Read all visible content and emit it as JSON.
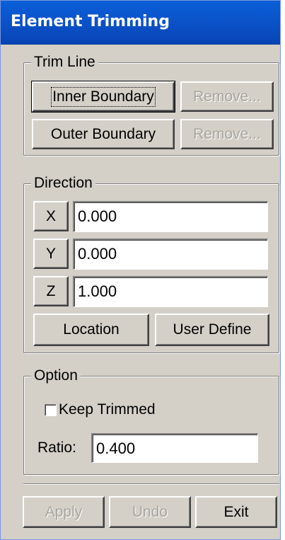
{
  "window": {
    "title": "Element Trimming"
  },
  "trim_line": {
    "legend": "Trim Line",
    "inner_boundary_label": "Inner Boundary",
    "outer_boundary_label": "Outer Boundary",
    "remove_inner_label": "Remove...",
    "remove_outer_label": "Remove..."
  },
  "direction": {
    "legend": "Direction",
    "x_label": "X",
    "y_label": "Y",
    "z_label": "Z",
    "x_value": "0.000",
    "y_value": "0.000",
    "z_value": "1.000",
    "location_label": "Location",
    "user_define_label": "User Define"
  },
  "option": {
    "legend": "Option",
    "keep_trimmed_label": "Keep Trimmed",
    "keep_trimmed_checked": false,
    "ratio_label": "Ratio:",
    "ratio_value": "0.400"
  },
  "footer": {
    "apply_label": "Apply",
    "undo_label": "Undo",
    "exit_label": "Exit"
  },
  "colors": {
    "titlebar": "#0a5fd8",
    "dialog_face": "#d4d0c8",
    "disabled_text": "#a8a59e"
  }
}
